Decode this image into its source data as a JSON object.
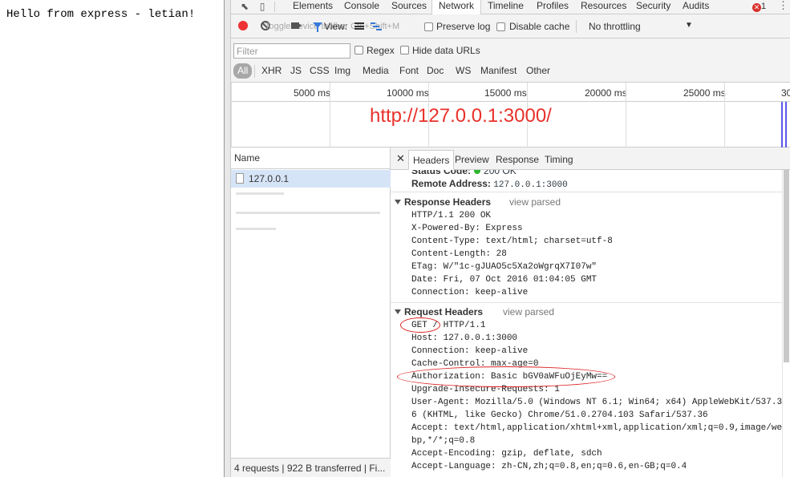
{
  "page": {
    "body_text": "Hello from express - letian!"
  },
  "devtools": {
    "tabs": [
      "Elements",
      "Console",
      "Sources",
      "Network",
      "Timeline",
      "Profiles",
      "Resources",
      "Security",
      "Audits"
    ],
    "active_tab": "Network",
    "error_count": "1",
    "toolbar": {
      "ghost_tooltip": "Toggle device toolbar  Ctrl+Shift+M",
      "view_label": "View:",
      "preserve_log": "Preserve log",
      "disable_cache": "Disable cache",
      "throttling": "No throttling"
    },
    "filter": {
      "placeholder": "Filter",
      "regex": "Regex",
      "hide_data_urls": "Hide data URLs",
      "types": [
        "All",
        "XHR",
        "JS",
        "CSS",
        "Img",
        "Media",
        "Font",
        "Doc",
        "WS",
        "Manifest",
        "Other"
      ]
    },
    "overview": {
      "ticks": [
        "5000 ms",
        "10000 ms",
        "15000 ms",
        "20000 ms",
        "25000 ms",
        "30"
      ],
      "annotation": "http://127.0.0.1:3000/"
    },
    "name_panel": {
      "header": "Name",
      "rows": [
        {
          "label": "127.0.0.1",
          "selected": true
        },
        {
          "label": "",
          "selected": false
        },
        {
          "label": "",
          "selected": false
        },
        {
          "label": "",
          "selected": false
        }
      ],
      "footer": "4 requests  |  922 B transferred  |  Fi..."
    },
    "details": {
      "tabs": [
        "Headers",
        "Preview",
        "Response",
        "Timing"
      ],
      "active_tab": "Headers",
      "general": {
        "status_label": "Status Code:",
        "status_value": "200 OK",
        "remote_label": "Remote Address:",
        "remote_value": "127.0.0.1:3000"
      },
      "response_headers": {
        "title": "Response Headers",
        "view_parsed": "view parsed",
        "lines": [
          "HTTP/1.1 200 OK",
          "X-Powered-By: Express",
          "Content-Type: text/html; charset=utf-8",
          "Content-Length: 28",
          "ETag: W/\"1c-gJUAO5c5Xa2oWgrqX7I07w\"",
          "Date: Fri, 07 Oct 2016 01:04:05 GMT",
          "Connection: keep-alive"
        ]
      },
      "request_headers": {
        "title": "Request Headers",
        "view_parsed": "view parsed",
        "lines": [
          "GET / HTTP/1.1",
          "Host: 127.0.0.1:3000",
          "Connection: keep-alive",
          "Cache-Control: max-age=0",
          "Authorization: Basic bGV0aWFuOjEyMw==",
          "Upgrade-Insecure-Requests: 1",
          "User-Agent: Mozilla/5.0 (Windows NT 6.1; Win64; x64) AppleWebKit/537.3",
          "6 (KHTML, like Gecko) Chrome/51.0.2704.103 Safari/537.36",
          "Accept: text/html,application/xhtml+xml,application/xml;q=0.9,image/we",
          "bp,*/*;q=0.8",
          "Accept-Encoding: gzip, deflate, sdch",
          "Accept-Language: zh-CN,zh;q=0.8,en;q=0.6,en-GB;q=0.4"
        ]
      }
    },
    "colors": {
      "accent_blue": "#3879d9",
      "record_red": "#e33333",
      "annotation_red": "#e8312a"
    }
  }
}
